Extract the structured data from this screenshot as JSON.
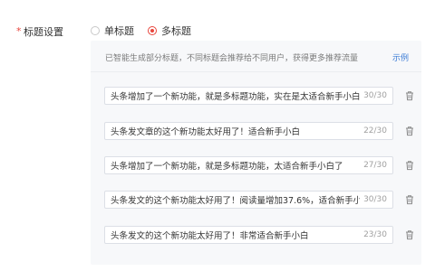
{
  "field": {
    "required_mark": "*",
    "label": "标题设置"
  },
  "radio": {
    "single": {
      "label": "单标题",
      "checked": false
    },
    "multi": {
      "label": "多标题",
      "checked": true
    }
  },
  "panel": {
    "hint": "已智能生成部分标题，不同标题会推荐给不同用户，获得更多推荐流量",
    "example_link": "示例"
  },
  "titles": [
    {
      "text": "头条增加了一个新功能，就是多标题功能，实在是太适合新手小白了",
      "count": "30/30"
    },
    {
      "text": "头条发文章的这个新功能太好用了！适合新手小白",
      "count": "22/30"
    },
    {
      "text": "头条增加了一个新功能，就是多标题功能，太适合新手小白了",
      "count": "27/30"
    },
    {
      "text": "头条发文的这个新功能太好用了！阅读量增加37.6%，适合新手小白",
      "count": "30/30"
    },
    {
      "text": "头条发文的这个新功能太好用了！非常适合新手小白",
      "count": "23/30"
    }
  ],
  "icons": {
    "delete": "trash-icon"
  },
  "colors": {
    "accent": "#e8453c",
    "link": "#3a7bd5",
    "panel_bg": "#f7f8fa"
  }
}
